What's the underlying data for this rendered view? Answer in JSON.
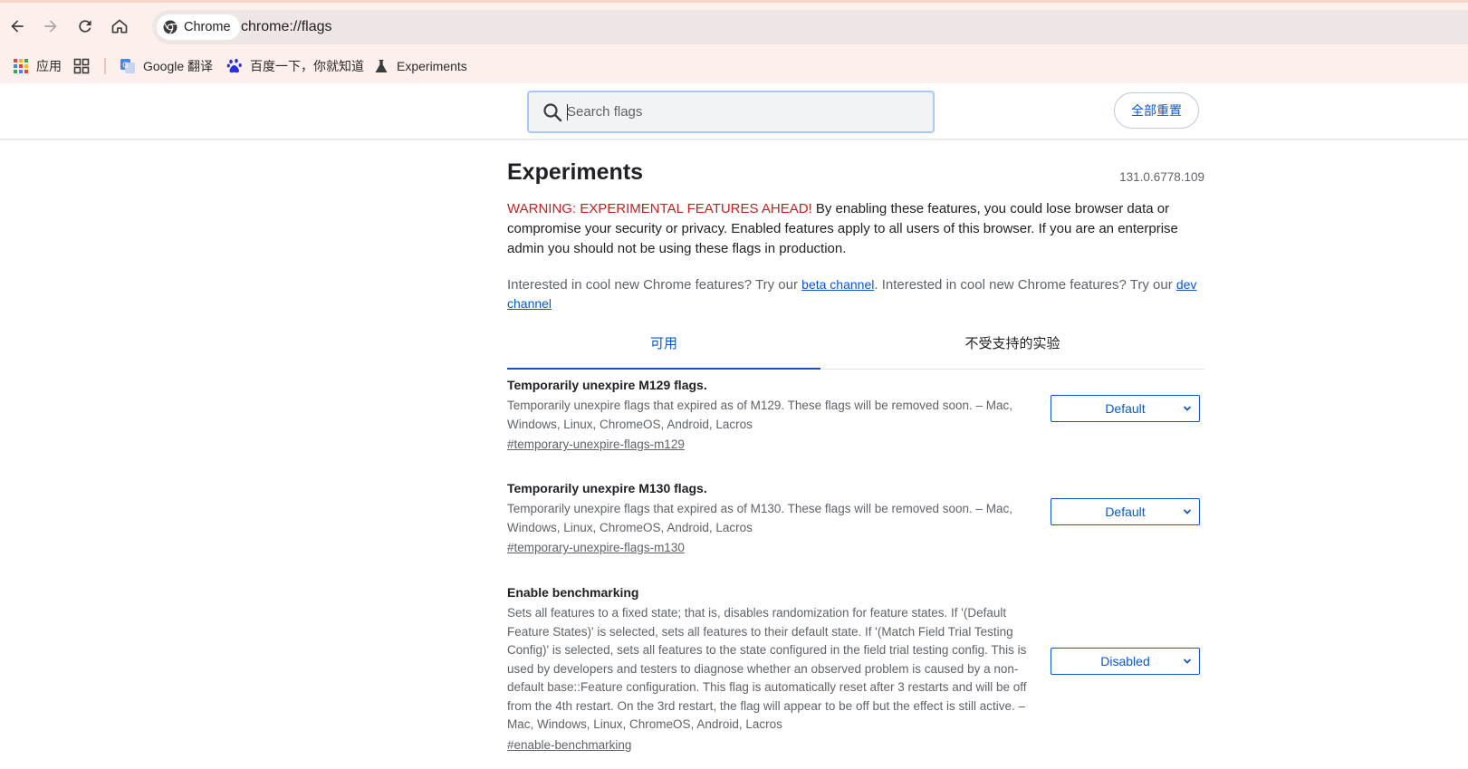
{
  "browser": {
    "chip_label": "Chrome",
    "url": "chrome://flags"
  },
  "bookmarks": {
    "apps_label": "应用",
    "items": [
      {
        "label": "Google 翻译",
        "icon": "google-translate-icon"
      },
      {
        "label": "百度一下，你就知道",
        "icon": "baidu-paw-icon"
      },
      {
        "label": "Experiments",
        "icon": "flask-icon"
      }
    ]
  },
  "header": {
    "search_placeholder": "Search flags",
    "reset_label": "全部重置"
  },
  "page": {
    "title": "Experiments",
    "version": "131.0.6778.109",
    "warning_prefix": "WARNING: EXPERIMENTAL FEATURES AHEAD!",
    "warning_body": " By enabling these features, you could lose browser data or compromise your security or privacy. Enabled features apply to all users of this browser. If you are an enterprise admin you should not be using these flags in production.",
    "interest_1": "Interested in cool new Chrome features? Try our ",
    "beta_link": "beta channel",
    "interest_2": ". Interested in cool new Chrome features? Try our ",
    "dev_link": "dev channel"
  },
  "tabs": {
    "available": "可用",
    "unavailable": "不受支持的实验"
  },
  "flags": [
    {
      "title": "Temporarily unexpire M129 flags.",
      "description": "Temporarily unexpire flags that expired as of M129. These flags will be removed soon. – Mac, Windows, Linux, ChromeOS, Android, Lacros",
      "link": "#temporary-unexpire-flags-m129",
      "value": "Default"
    },
    {
      "title": "Temporarily unexpire M130 flags.",
      "description": "Temporarily unexpire flags that expired as of M130. These flags will be removed soon. – Mac, Windows, Linux, ChromeOS, Android, Lacros",
      "link": "#temporary-unexpire-flags-m130",
      "value": "Default"
    },
    {
      "title": "Enable benchmarking",
      "description": "Sets all features to a fixed state; that is, disables randomization for feature states. If '(Default Feature States)' is selected, sets all features to their default state. If '(Match Field Trial Testing Config)' is selected, sets all features to the state configured in the field trial testing config. This is used by developers and testers to diagnose whether an observed problem is caused by a non-default base::Feature configuration. This flag is automatically reset after 3 restarts and will be off from the 4th restart. On the 3rd restart, the flag will appear to be off but the effect is still active. – Mac, Windows, Linux, ChromeOS, Android, Lacros",
      "link": "#enable-benchmarking",
      "value": "Disabled"
    }
  ],
  "colors": {
    "accent": "#0b57d0",
    "warning": "#c5221f",
    "toolbar_bg": "#fdf0ec"
  }
}
